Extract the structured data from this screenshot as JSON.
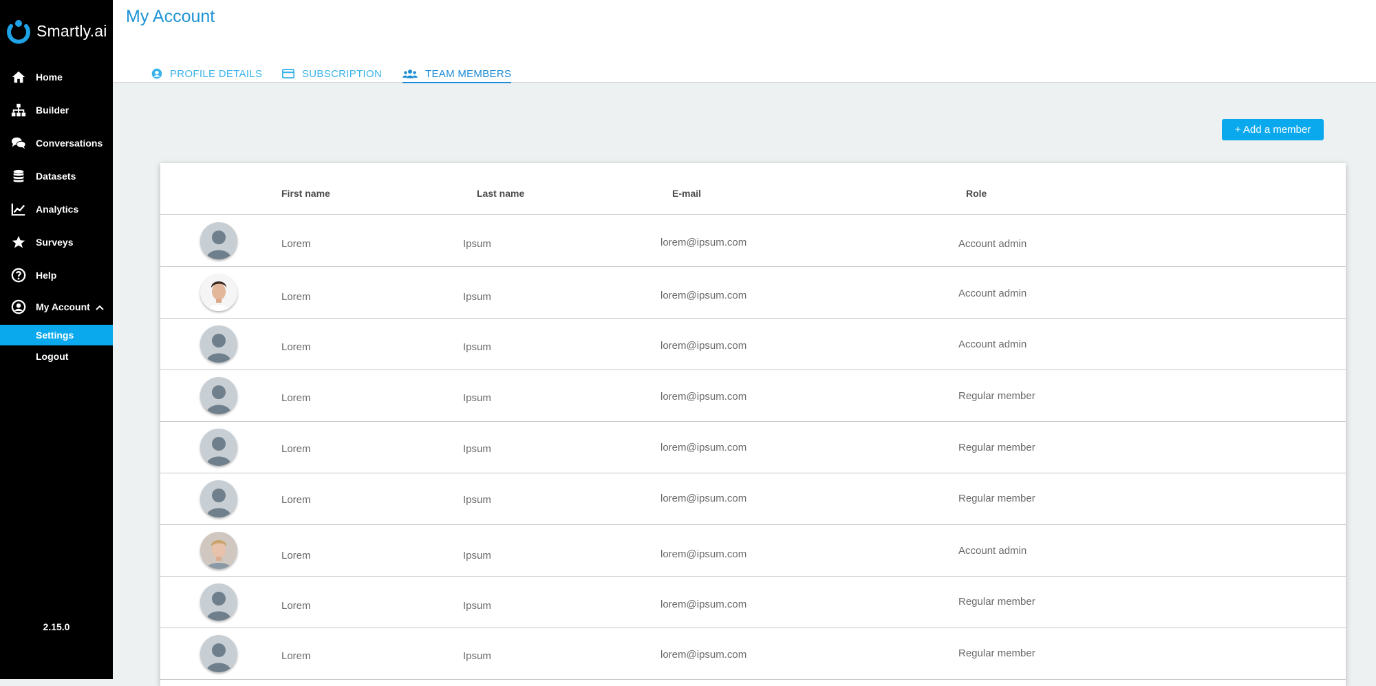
{
  "app": {
    "name": "Smartly.ai",
    "version": "2.15.0"
  },
  "sidebar": {
    "items": [
      {
        "label": "Home",
        "icon": "home-icon"
      },
      {
        "label": "Builder",
        "icon": "sitemap-icon"
      },
      {
        "label": "Conversations",
        "icon": "comments-icon"
      },
      {
        "label": "Datasets",
        "icon": "database-icon"
      },
      {
        "label": "Analytics",
        "icon": "line-chart-icon"
      },
      {
        "label": "Surveys",
        "icon": "star-icon"
      },
      {
        "label": "Help",
        "icon": "question-circle-icon"
      },
      {
        "label": "My Account",
        "icon": "user-circle-icon"
      }
    ],
    "subitems": [
      {
        "label": "Settings",
        "active": true
      },
      {
        "label": "Logout",
        "active": false
      }
    ]
  },
  "header": {
    "title": "My Account",
    "tabs": [
      {
        "label": "PROFILE DETAILS",
        "icon": "user-circle-icon",
        "active": false
      },
      {
        "label": "SUBSCRIPTION",
        "icon": "credit-card-icon",
        "active": false
      },
      {
        "label": "TEAM MEMBERS",
        "icon": "users-icon",
        "active": true
      }
    ]
  },
  "team": {
    "add_button": "+ Add a member",
    "columns": [
      "First name",
      "Last name",
      "E-mail",
      "Role"
    ],
    "rows": [
      {
        "avatar": "default",
        "first": "Lorem",
        "last": "Ipsum",
        "email": "lorem@ipsum.com",
        "role": "Account admin"
      },
      {
        "avatar": "photo-dark-hair",
        "first": "Lorem",
        "last": "Ipsum",
        "email": "lorem@ipsum.com",
        "role": "Account admin"
      },
      {
        "avatar": "default",
        "first": "Lorem",
        "last": "Ipsum",
        "email": "lorem@ipsum.com",
        "role": "Account admin"
      },
      {
        "avatar": "default",
        "first": "Lorem",
        "last": "Ipsum",
        "email": "lorem@ipsum.com",
        "role": "Regular member"
      },
      {
        "avatar": "default",
        "first": "Lorem",
        "last": "Ipsum",
        "email": "lorem@ipsum.com",
        "role": "Regular member"
      },
      {
        "avatar": "default",
        "first": "Lorem",
        "last": "Ipsum",
        "email": "lorem@ipsum.com",
        "role": "Regular member"
      },
      {
        "avatar": "photo-blond",
        "first": "Lorem",
        "last": "Ipsum",
        "email": "lorem@ipsum.com",
        "role": "Account admin"
      },
      {
        "avatar": "default",
        "first": "Lorem",
        "last": "Ipsum",
        "email": "lorem@ipsum.com",
        "role": "Regular member"
      },
      {
        "avatar": "default",
        "first": "Lorem",
        "last": "Ipsum",
        "email": "lorem@ipsum.com",
        "role": "Regular member"
      }
    ]
  },
  "colors": {
    "accent": "#0aa9ee",
    "title": "#1e94d6",
    "sidebar_bg": "#000000",
    "content_bg": "#eef1f2"
  }
}
